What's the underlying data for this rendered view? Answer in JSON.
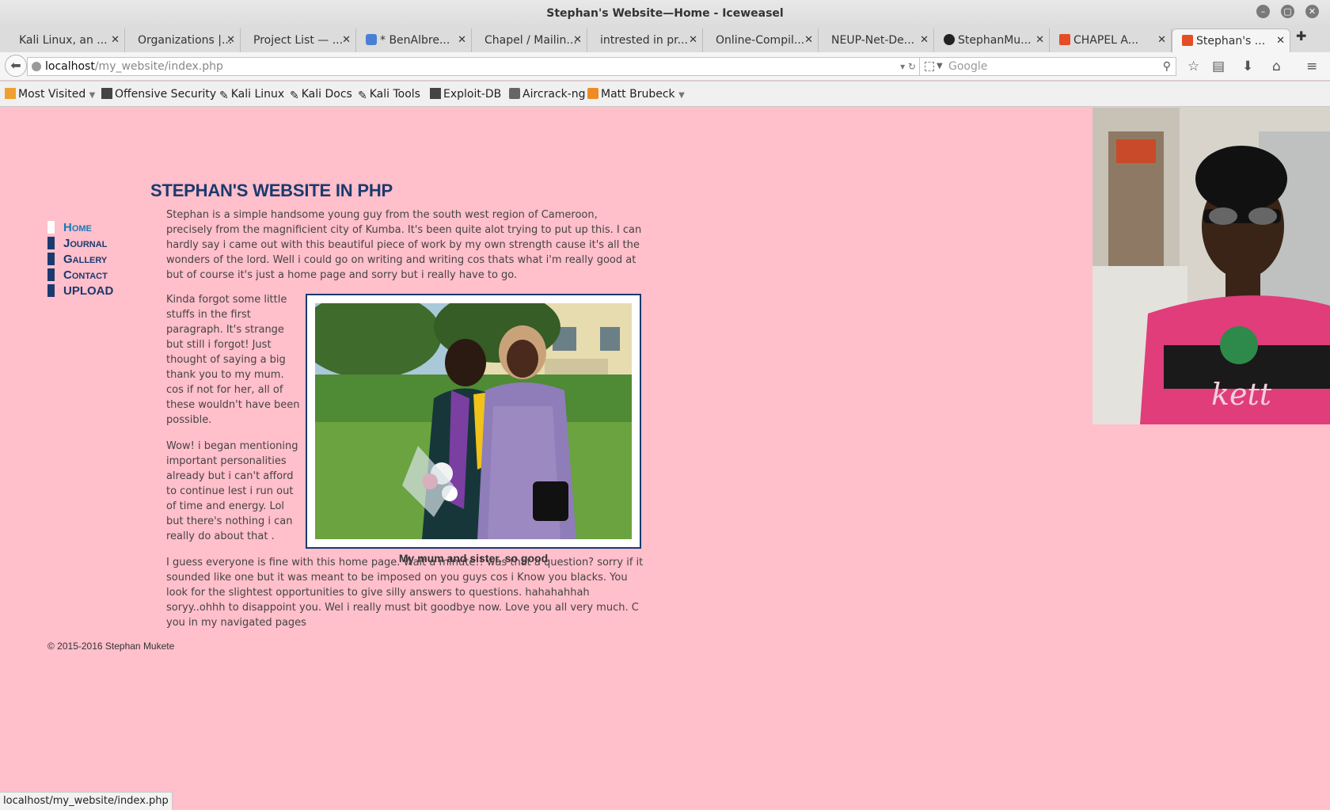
{
  "window": {
    "title": "Stephan's Website—Home - Iceweasel"
  },
  "tabs": [
    {
      "label": "Kali Linux, an ...",
      "icon": "kali-icon"
    },
    {
      "label": "Organizations |...",
      "icon": "none"
    },
    {
      "label": "Project List — ...",
      "icon": "none"
    },
    {
      "label": "* BenAlbre...",
      "icon": "cloud-icon"
    },
    {
      "label": "Chapel / Mailin...",
      "icon": "none"
    },
    {
      "label": "intrested in pr...",
      "icon": "none"
    },
    {
      "label": "Online-Compil...",
      "icon": "none"
    },
    {
      "label": "NEUP-Net-De...",
      "icon": "none"
    },
    {
      "label": "StephanMu...",
      "icon": "github-icon"
    },
    {
      "label": "CHAPEL A...",
      "icon": "html5-icon"
    },
    {
      "label": "Stephan's ...",
      "icon": "html5-icon",
      "active": true
    }
  ],
  "navbar": {
    "url_host": "localhost",
    "url_path": "/my_website/index.php",
    "search_placeholder": "Google"
  },
  "bookmarks": [
    {
      "label": "Most Visited",
      "dropdown": true
    },
    {
      "label": "Offensive Security"
    },
    {
      "label": "Kali Linux"
    },
    {
      "label": "Kali Docs"
    },
    {
      "label": "Kali Tools"
    },
    {
      "label": "Exploit-DB"
    },
    {
      "label": "Aircrack-ng"
    },
    {
      "label": "Matt Brubeck",
      "dropdown": true
    }
  ],
  "page": {
    "heading": "STEPHAN'S WEBSITE IN PHP",
    "nav": [
      {
        "label": "Home",
        "current": true
      },
      {
        "label": "Journal"
      },
      {
        "label": "Gallery"
      },
      {
        "label": "Contact"
      },
      {
        "label": "UPLOAD"
      }
    ],
    "p1": "Stephan is a simple handsome young guy from the south west region of Cameroon, precisely from the magnificient city of Kumba. It's been quite alot trying to put up this. I can hardly say i came out with this beautiful piece of work by my own strength cause it's all the wonders of the lord. Well i could go on writing and writing cos thats what i'm really good at but of course it's just a home page and sorry but i really have to go.",
    "p2": "Kinda forgot some little stuffs in the first paragraph. It's strange but still i forgot! Just thought of saying a big thank you to my mum. cos if not for her, all of these wouldn't have been possible.",
    "p3": "Wow! i began mentioning important personalities already but i can't afford to continue lest i run out of time and energy. Lol but there's nothing i can really do about that .",
    "p4": "I guess everyone is fine with this home page. Wait a minute!! was that a question? sorry if it sounded like one but it was meant to be imposed on you guys cos i Know you blacks. You look for the slightest opportunities to give silly answers to questions. hahahahhah soryy..ohhh to disappoint you. Wel i really must bit goodbye now. Love you all very much. C you in my navigated pages",
    "caption": "My mum and sister. so good",
    "footer": "© 2015-2016 Stephan Mukete"
  },
  "statusbar": "localhost/my_website/index.php"
}
